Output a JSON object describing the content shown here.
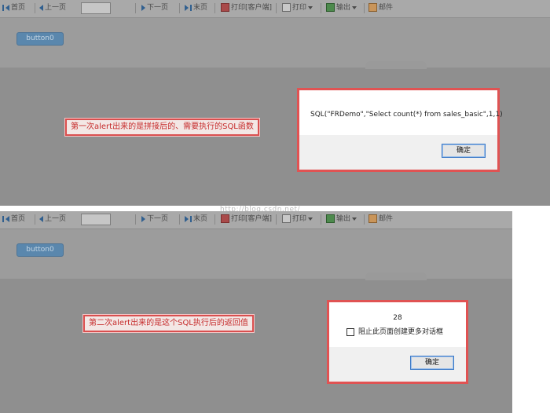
{
  "toolbar": {
    "first_page": "首页",
    "prev_page": "上一页",
    "next_page": "下一页",
    "last_page": "末页",
    "print_client": "打印[客户端]",
    "print": "打印",
    "export": "输出",
    "email": "邮件"
  },
  "report": {
    "button_label": "button0"
  },
  "panel1": {
    "annotation": "第一次alert出来的是拼接后的、需要执行的SQL函数",
    "alert_message": "SQL(\"FRDemo\",\"Select count(*) from sales_basic\",1,1)",
    "ok_label": "确定"
  },
  "panel2": {
    "annotation": "第二次alert出来的是这个SQL执行后的返回值",
    "alert_message": "28",
    "checkbox_label": "阻止此页面创建更多对话框",
    "ok_label": "确定"
  },
  "watermark": "http://blog.csdn.net/",
  "colors": {
    "overlay": "#9c9c9c",
    "highlight_border": "#d94f4f",
    "annotation_text": "#c62b2b",
    "button_blue": "#5a87ad"
  }
}
